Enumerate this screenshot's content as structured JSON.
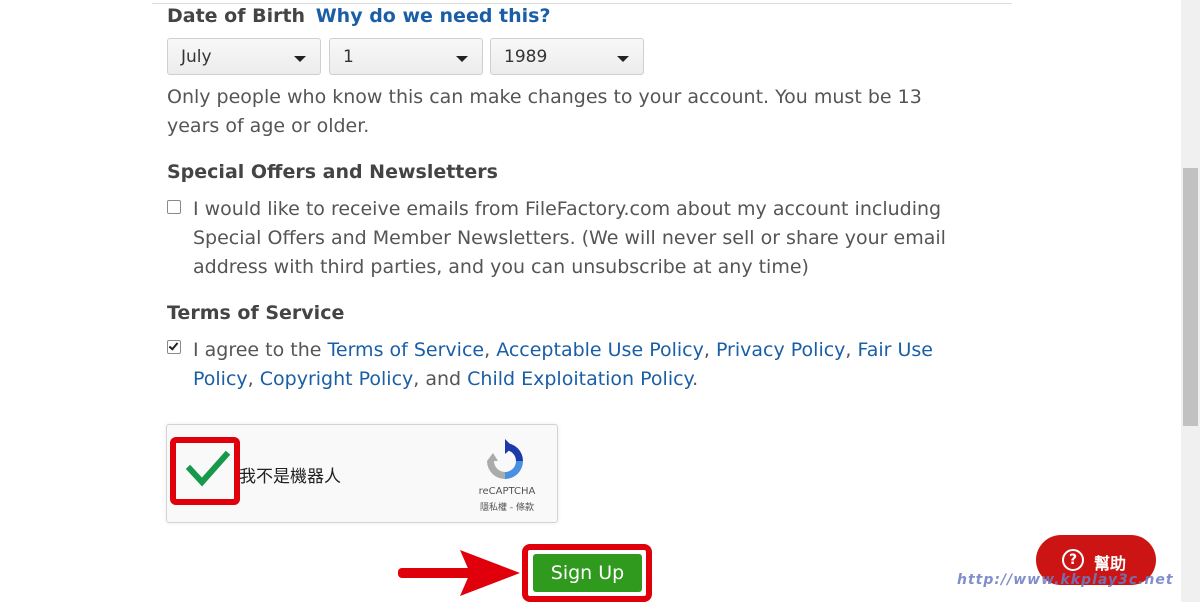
{
  "dob": {
    "label": "Date of Birth",
    "why_link": "Why do we need this?",
    "month": "July",
    "day": "1",
    "year": "1989",
    "help_text": "Only people who know this can make changes to your account. You must be 13 years of age or older."
  },
  "offers": {
    "title": "Special Offers and Newsletters",
    "checkbox_text": "I would like to receive emails from FileFactory.com about my account including Special Offers and Member Newsletters. (We will never sell or share your email address with third parties, and you can unsubscribe at any time)",
    "checked": false
  },
  "terms": {
    "title": "Terms of Service",
    "prefix": "I agree to the",
    "links": [
      "Terms of Service",
      "Acceptable Use Policy",
      "Privacy Policy",
      "Fair Use Policy",
      "Copyright Policy",
      "Child Exploitation Policy"
    ],
    "sep": ",",
    "and": ", and",
    "end": ".",
    "checked": true
  },
  "recaptcha": {
    "label": "我不是機器人",
    "brand": "reCAPTCHA",
    "links": "隱私權 - 條款",
    "checked": true
  },
  "signup": {
    "label": "Sign Up"
  },
  "help": {
    "icon": "?",
    "label": "幫助"
  },
  "watermark": "http://www.kkplay3c.net",
  "colors": {
    "link": "#1a5fa6",
    "highlight": "#e0000b",
    "signup_bg": "#2f9a1e",
    "help_bg": "#cc1414"
  }
}
